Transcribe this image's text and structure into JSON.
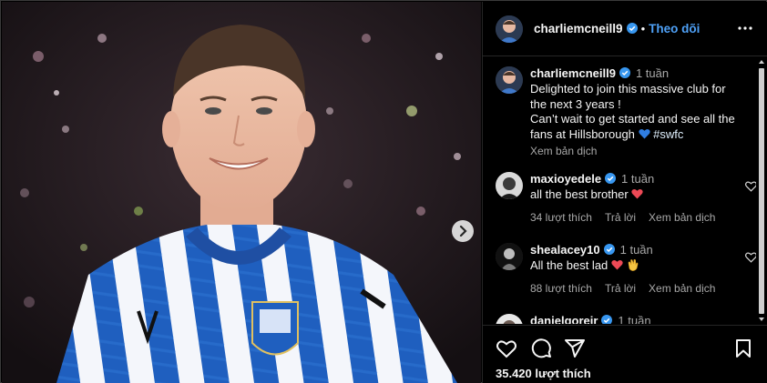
{
  "post": {
    "username": "charliemcneill9",
    "follow_label": "Theo dõi",
    "dot": "•",
    "caption": {
      "username": "charliemcneill9",
      "time": "1 tuần",
      "line1": "Delighted to join this massive club for",
      "line2": "the next 3 years !",
      "line3": "Can’t wait to get started and see all the",
      "line4": "fans at Hillsborough",
      "line4_tail": "#swfc",
      "translate": "Xem bản dịch"
    },
    "comments": [
      {
        "username": "maxioyedele",
        "time": "1 tuần",
        "text": "all the best brother",
        "likes": "34 lượt thích",
        "reply": "Trả lời",
        "translate": "Xem bản dịch"
      },
      {
        "username": "shealacey10",
        "time": "1 tuần",
        "text": "All the best lad",
        "likes": "88 lượt thích",
        "reply": "Trả lời",
        "translate": "Xem bản dịch"
      },
      {
        "username": "danielgoreir",
        "time": "1 tuần"
      }
    ],
    "like_count": "35.420 lượt thích"
  },
  "colors": {
    "accent_blue": "#4ea0f6",
    "kit_blue": "#1f5fbf",
    "heart_red": "#ed4956",
    "background": "#000000"
  },
  "icons": [
    "verified-badge-icon",
    "more-options-icon",
    "next-arrow-icon",
    "heart-icon",
    "comment-icon",
    "share-icon",
    "bookmark-icon",
    "blue-heart-emoji",
    "clap-emoji",
    "red-heart-emoji"
  ]
}
